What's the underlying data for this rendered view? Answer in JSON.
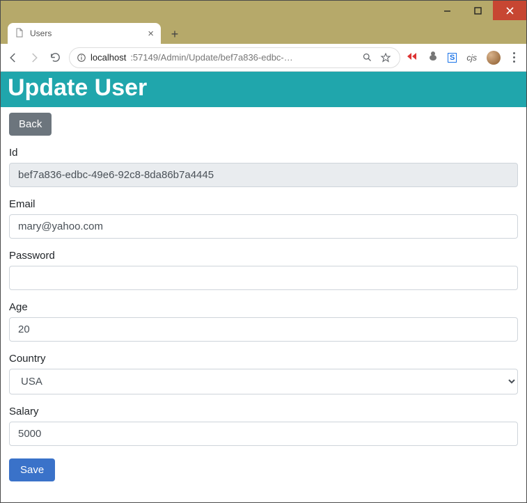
{
  "window": {
    "tab_title": "Users"
  },
  "address": {
    "host": "localhost",
    "path": ":57149/Admin/Update/bef7a836-edbc-…"
  },
  "extensions": {
    "cjs_label": "cjs"
  },
  "header": {
    "title": "Update User"
  },
  "buttons": {
    "back": "Back",
    "save": "Save"
  },
  "form": {
    "id": {
      "label": "Id",
      "value": "bef7a836-edbc-49e6-92c8-8da86b7a4445"
    },
    "email": {
      "label": "Email",
      "value": "mary@yahoo.com"
    },
    "password": {
      "label": "Password",
      "value": ""
    },
    "age": {
      "label": "Age",
      "value": "20"
    },
    "country": {
      "label": "Country",
      "value": "USA"
    },
    "salary": {
      "label": "Salary",
      "value": "5000"
    }
  }
}
